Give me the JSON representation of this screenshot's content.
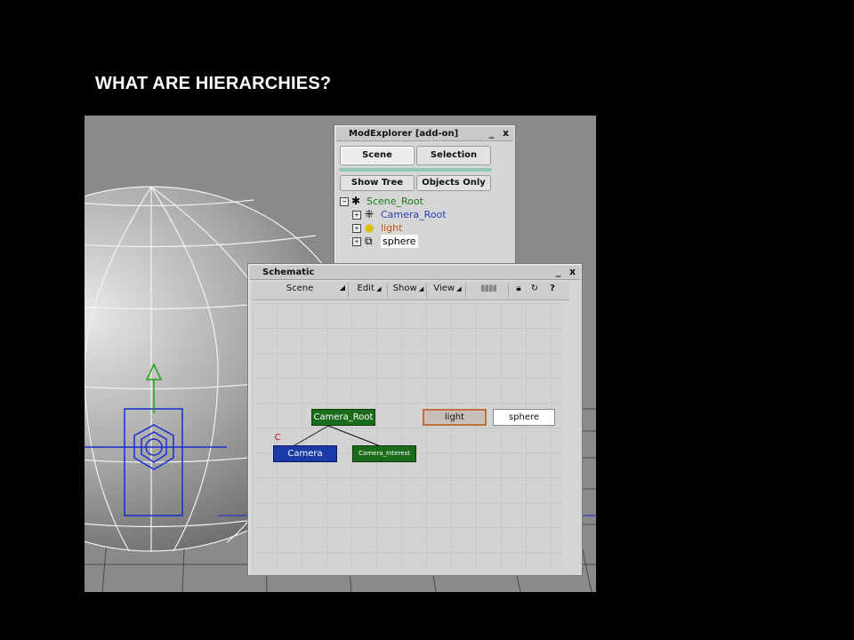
{
  "slide": {
    "title": "WHAT ARE HIERARCHIES?"
  },
  "modexplorer": {
    "title": "ModExplorer [add-on]",
    "minimize": "_",
    "close": "x",
    "tabs": [
      {
        "label": "Scene"
      },
      {
        "label": "Selection"
      }
    ],
    "buttons": {
      "show_tree": "Show Tree",
      "objects_only": "Objects Only"
    },
    "tree": [
      {
        "label": "Scene_Root",
        "color": "#1c7a1c"
      },
      {
        "label": "Camera_Root",
        "color": "#2b3fb0"
      },
      {
        "label": "light",
        "color": "#c05a10"
      },
      {
        "label": "sphere",
        "color": "#111111"
      }
    ]
  },
  "schematic": {
    "title": "Schematic",
    "minimize": "_",
    "close": "x",
    "menu": {
      "scene": "Scene",
      "edit": "Edit",
      "show": "Show",
      "view": "View",
      "help": "?"
    },
    "nodes": {
      "camera_root": "Camera_Root",
      "camera": "Camera",
      "camera_marker": "C",
      "camera_interest": "Camera_Interest",
      "light": "light",
      "sphere": "sphere"
    },
    "colors": {
      "green": "#1a6b1a",
      "blue": "#1a3aa8",
      "orange": "#c07040"
    }
  }
}
